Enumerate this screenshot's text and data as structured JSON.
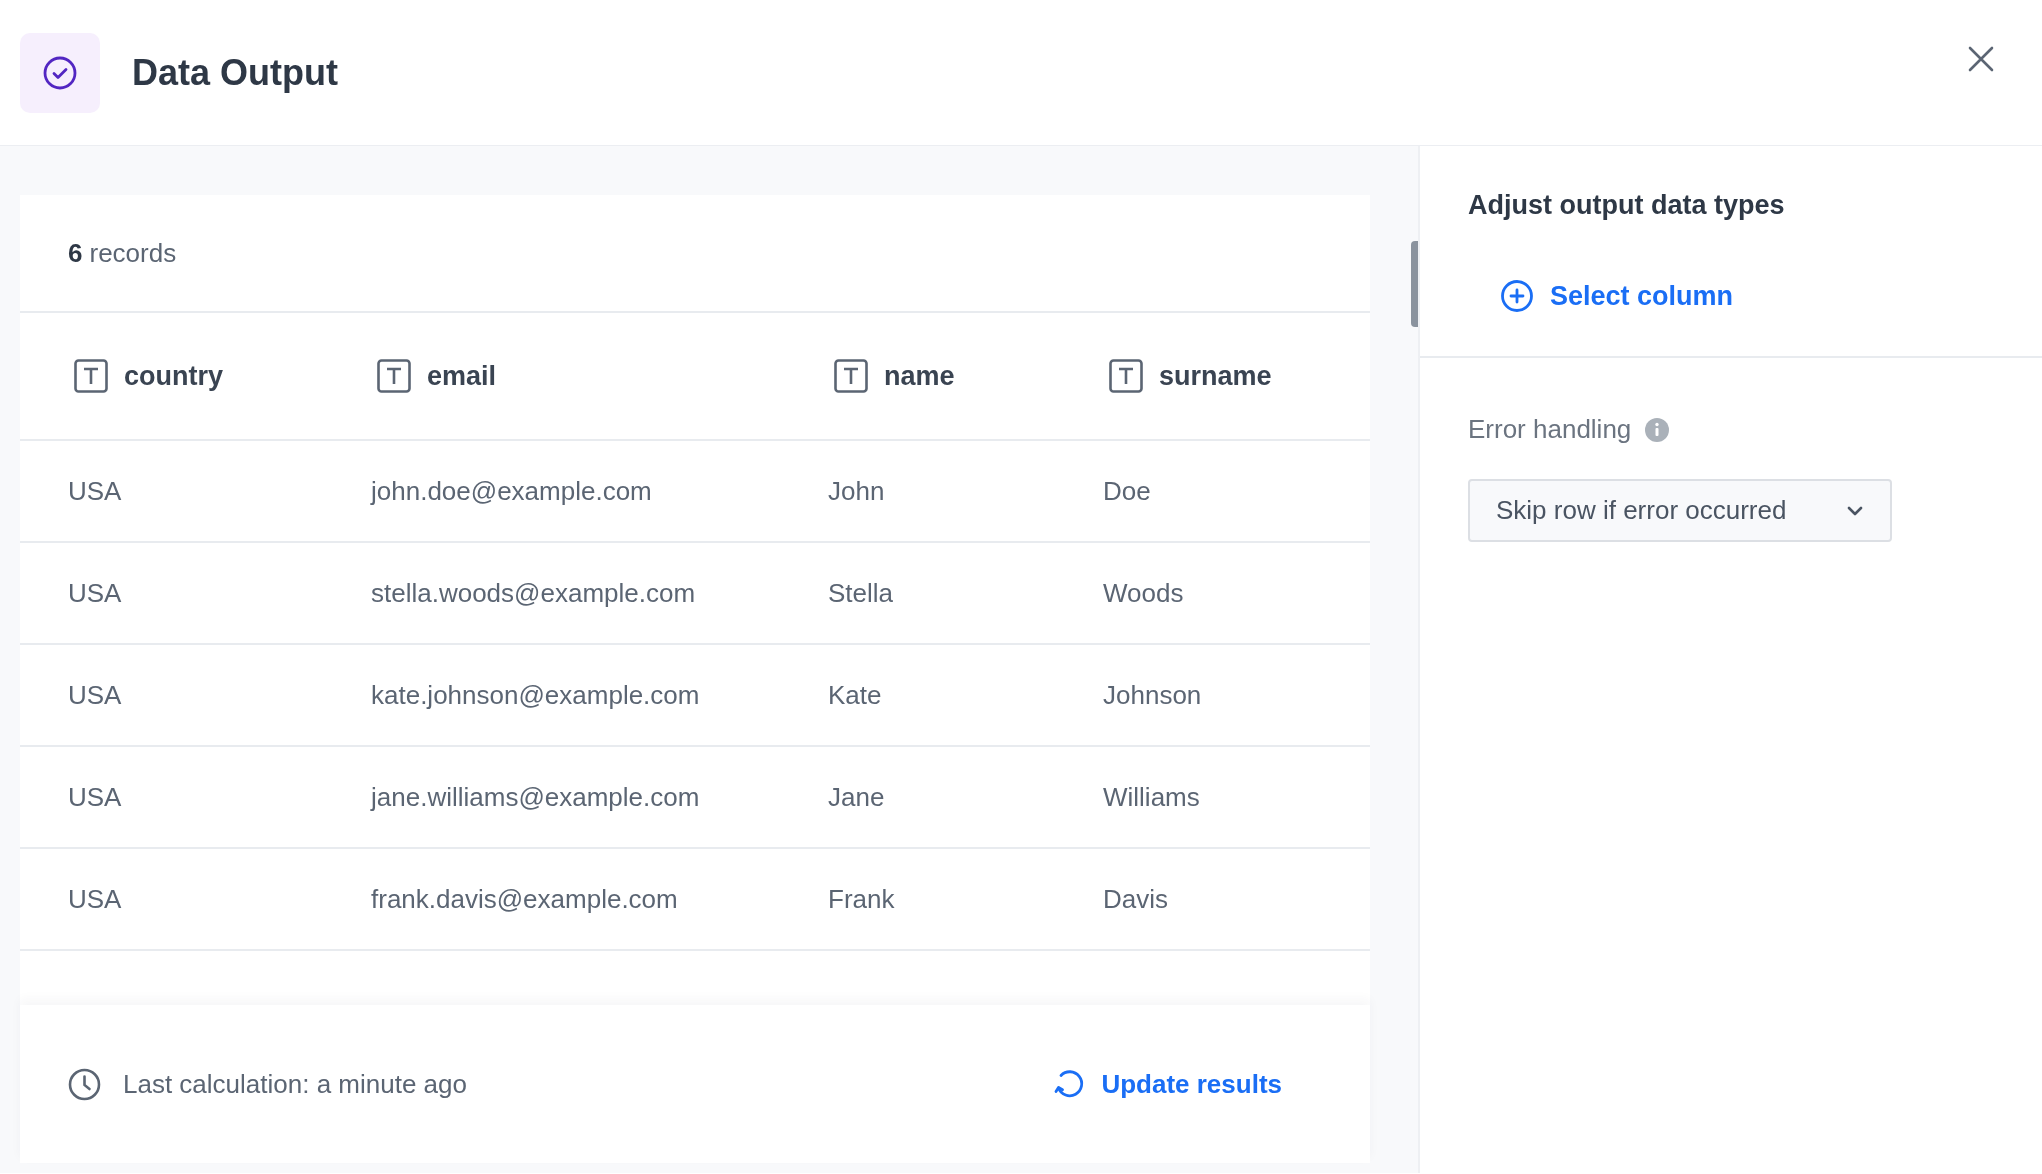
{
  "header": {
    "title": "Data Output"
  },
  "results": {
    "record_count": "6",
    "record_label": "records",
    "columns": [
      {
        "label": "country"
      },
      {
        "label": "email"
      },
      {
        "label": "name"
      },
      {
        "label": "surname"
      }
    ],
    "rows": [
      [
        "USA",
        "john.doe@example.com",
        "John",
        "Doe"
      ],
      [
        "USA",
        "stella.woods@example.com",
        "Stella",
        "Woods"
      ],
      [
        "USA",
        "kate.johnson@example.com",
        "Kate",
        "Johnson"
      ],
      [
        "USA",
        "jane.williams@example.com",
        "Jane",
        "Williams"
      ],
      [
        "USA",
        "frank.davis@example.com",
        "Frank",
        "Davis"
      ]
    ],
    "last_calculation": "Last calculation: a minute ago",
    "update_button": "Update results"
  },
  "side_panel": {
    "title": "Adjust output data types",
    "select_column": "Select column",
    "error_handling_label": "Error handling",
    "error_handling_value": "Skip row if error occurred"
  }
}
